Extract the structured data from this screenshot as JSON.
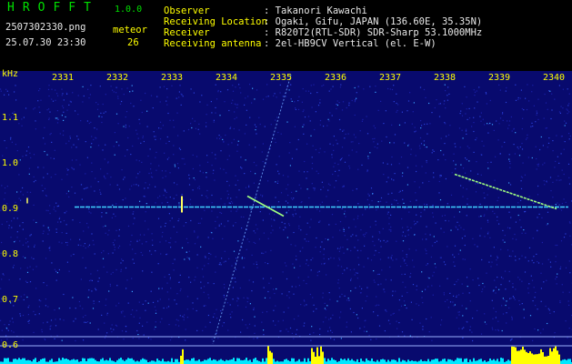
{
  "header": {
    "app_logo": "HROFFT",
    "app_version": "1.0.0",
    "filename": "2507302330.png",
    "datetime": "25.07.30 23:30",
    "meteor_label": "meteor",
    "meteor_count": "26",
    "info_labels": [
      "Observer",
      "Receiving Location",
      "Receiver",
      "Receiving antenna"
    ],
    "info_values": [
      ": Takanori Kawachi",
      ": Ogaki, Gifu, JAPAN (136.60E, 35.35N)",
      ": R820T2(RTL-SDR) SDR-Sharp 53.1000MHz",
      ": 2el-HB9CV Vertical (el. E-W)"
    ]
  },
  "spectrogram": {
    "y_unit": "kHz",
    "x_ticks": [
      "2331",
      "2332",
      "2333",
      "2334",
      "2335",
      "2336",
      "2337",
      "2338",
      "2339",
      "2340"
    ],
    "y_ticks": [
      "1.1",
      "1.0",
      "0.9",
      "0.8",
      "0.7",
      "0.6"
    ],
    "carrier_freq_khz": 0.905,
    "background_color": "#080a6e",
    "carrier_color": "#40d0ff",
    "meteor_color": "#a0ff80",
    "power_bar_color": "#00e8ff",
    "power_peak_color": "#ffff00"
  }
}
